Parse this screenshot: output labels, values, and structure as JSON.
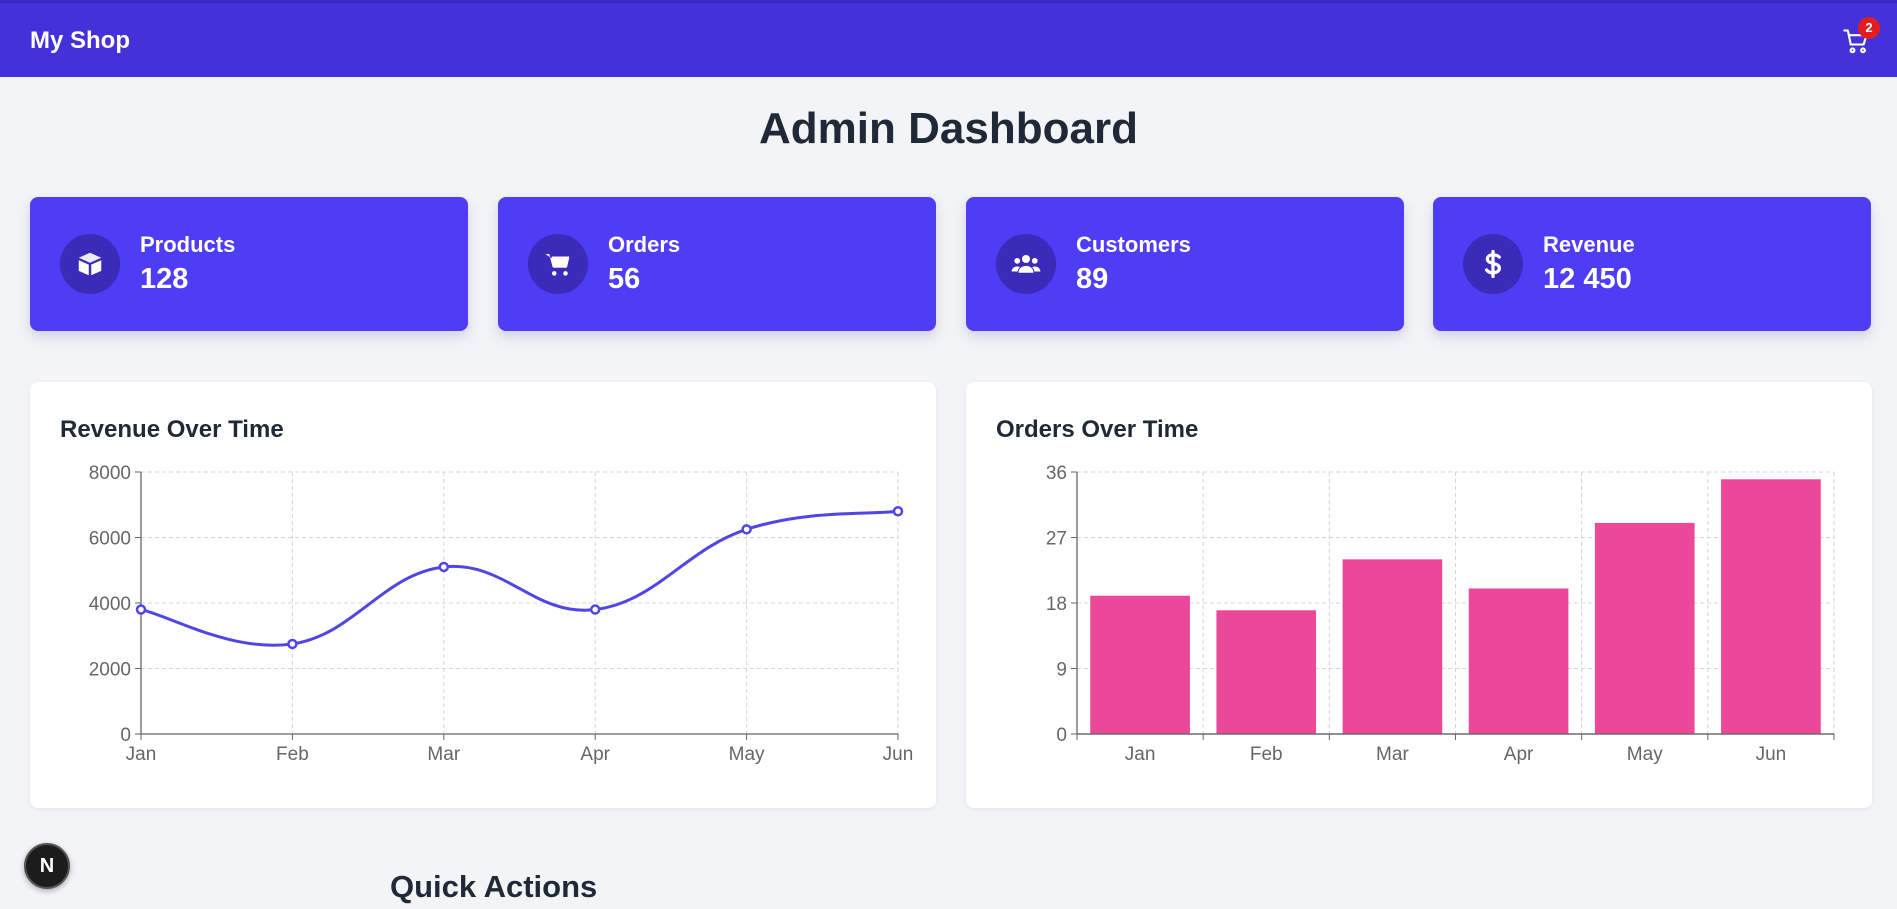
{
  "header": {
    "brand": "My Shop",
    "cart_count": "2",
    "color": "#4431da"
  },
  "page": {
    "title": "Admin Dashboard"
  },
  "stats": [
    {
      "label": "Products",
      "value": "128",
      "icon": "box-open-icon"
    },
    {
      "label": "Orders",
      "value": "56",
      "icon": "shopping-cart-icon"
    },
    {
      "label": "Customers",
      "value": "89",
      "icon": "users-icon"
    },
    {
      "label": "Revenue",
      "value": "12 450",
      "icon": "dollar-icon"
    }
  ],
  "chart_data": [
    {
      "type": "line",
      "title": "Revenue Over Time",
      "categories": [
        "Jan",
        "Feb",
        "Mar",
        "Apr",
        "May",
        "Jun"
      ],
      "values": [
        3800,
        2750,
        5100,
        3800,
        6250,
        6800
      ],
      "ylim": [
        0,
        8000
      ],
      "yticks": [
        "0",
        "2000",
        "4000",
        "6000",
        "8000"
      ],
      "grid": true,
      "color": "#4f46e5"
    },
    {
      "type": "bar",
      "title": "Orders Over Time",
      "categories": [
        "Jan",
        "Feb",
        "Mar",
        "Apr",
        "May",
        "Jun"
      ],
      "values": [
        19,
        17,
        24,
        20,
        29,
        35
      ],
      "ylim": [
        0,
        36
      ],
      "yticks": [
        "0",
        "9",
        "18",
        "27",
        "36"
      ],
      "grid": true,
      "color": "#ec4899"
    }
  ],
  "fab": {
    "label": "N"
  },
  "sections": {
    "quick_actions": "Quick Actions"
  }
}
